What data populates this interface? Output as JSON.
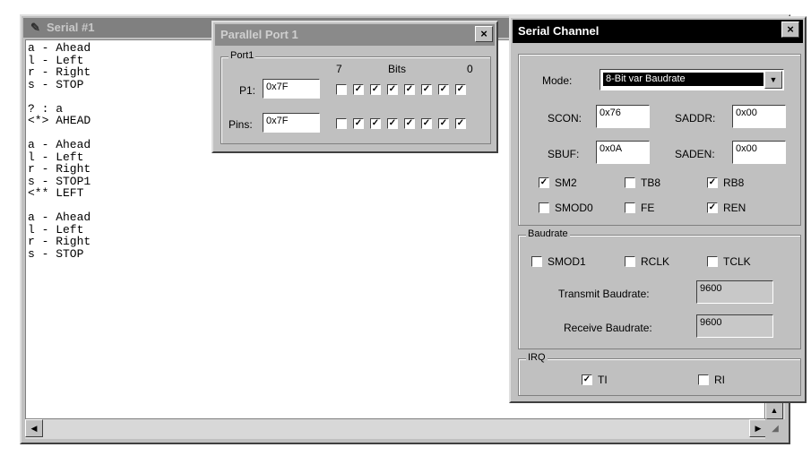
{
  "serial_window": {
    "title": "Serial #1",
    "lines": [
      "a - Ahead",
      "l - Left",
      "r - Right",
      "s - STOP",
      "",
      "? : a",
      "<*> AHEAD",
      "",
      "a - Ahead",
      "l - Left",
      "r - Right",
      "s - STOP1",
      "<** LEFT",
      "",
      "a - Ahead",
      "l - Left",
      "r - Right",
      "s - STOP"
    ]
  },
  "parallel_window": {
    "title": "Parallel Port 1",
    "group": "Port1",
    "bits_label": "Bits",
    "bit_high": "7",
    "bit_low": "0",
    "p1_label": "P1:",
    "p1_value": "0x7F",
    "pins_label": "Pins:",
    "pins_value": "0x7F",
    "p1_bits": [
      false,
      true,
      true,
      true,
      true,
      true,
      true,
      true
    ],
    "pins_bits": [
      false,
      true,
      true,
      true,
      true,
      true,
      true,
      true
    ]
  },
  "serial_channel": {
    "title": "Serial Channel",
    "mode_label": "Mode:",
    "mode_value": "8-Bit var Baudrate",
    "scon_label": "SCON:",
    "scon_value": "0x76",
    "saddr_label": "SADDR:",
    "saddr_value": "0x00",
    "sbuf_label": "SBUF:",
    "sbuf_value": "0x0A",
    "saden_label": "SADEN:",
    "saden_value": "0x00",
    "flags": [
      {
        "label": "SM2",
        "checked": true
      },
      {
        "label": "TB8",
        "checked": false
      },
      {
        "label": "RB8",
        "checked": true
      },
      {
        "label": "SMOD0",
        "checked": false
      },
      {
        "label": "FE",
        "checked": false
      },
      {
        "label": "REN",
        "checked": true
      }
    ],
    "baudrate_group": "Baudrate",
    "baud_flags": [
      {
        "label": "SMOD1",
        "checked": false
      },
      {
        "label": "RCLK",
        "checked": false
      },
      {
        "label": "TCLK",
        "checked": false
      }
    ],
    "tx_label": "Transmit Baudrate:",
    "tx_value": "9600",
    "rx_label": "Receive Baudrate:",
    "rx_value": "9600",
    "irq_group": "IRQ",
    "irq_flags": [
      {
        "label": "TI",
        "checked": true
      },
      {
        "label": "RI",
        "checked": false
      }
    ]
  }
}
